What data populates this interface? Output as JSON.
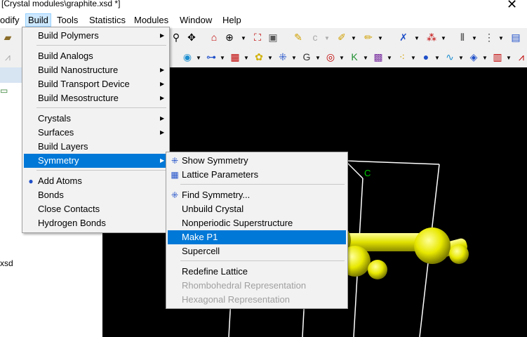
{
  "window": {
    "title": "[Crystal modules\\graphite.xsd *]",
    "close_glyph": "✕"
  },
  "menubar": {
    "items": [
      "odify",
      "Build",
      "Tools",
      "Statistics",
      "Modules",
      "Window",
      "Help"
    ]
  },
  "left_panel": {
    "file_label": "xsd"
  },
  "build_menu": {
    "items": [
      {
        "label": "Build Polymers",
        "submenu": true
      },
      {
        "label": "Build Analogs",
        "submenu": false
      },
      {
        "label": "Build Nanostructure",
        "submenu": true
      },
      {
        "label": "Build Transport Device",
        "submenu": true
      },
      {
        "label": "Build Mesostructure",
        "submenu": true
      },
      {
        "label": "Crystals",
        "submenu": true
      },
      {
        "label": "Surfaces",
        "submenu": true
      },
      {
        "label": "Build Layers",
        "submenu": false
      },
      {
        "label": "Symmetry",
        "submenu": true,
        "selected": true
      },
      {
        "label": "Add Atoms",
        "submenu": false
      },
      {
        "label": "Bonds",
        "submenu": false
      },
      {
        "label": "Close Contacts",
        "submenu": false
      },
      {
        "label": "Hydrogen Bonds",
        "submenu": false
      }
    ]
  },
  "symmetry_menu": {
    "items": [
      {
        "label": "Show Symmetry"
      },
      {
        "label": "Lattice Parameters"
      },
      {
        "label": "Find Symmetry..."
      },
      {
        "label": "Unbuild Crystal"
      },
      {
        "label": "Nonperiodic Superstructure"
      },
      {
        "label": "Make P1",
        "selected": true
      },
      {
        "label": "Supercell"
      },
      {
        "label": "Redefine Lattice"
      },
      {
        "label": "Rhombohedral Representation",
        "disabled": true
      },
      {
        "label": "Hexagonal Representation",
        "disabled": true
      }
    ]
  },
  "viewport": {
    "atom_label": "C"
  },
  "colors": {
    "menu_highlight": "#0078d7",
    "viewport_bg": "#000000",
    "atom": "#e8e800",
    "atom_label": "#00cc00",
    "cell_lines": "#ffffff"
  }
}
